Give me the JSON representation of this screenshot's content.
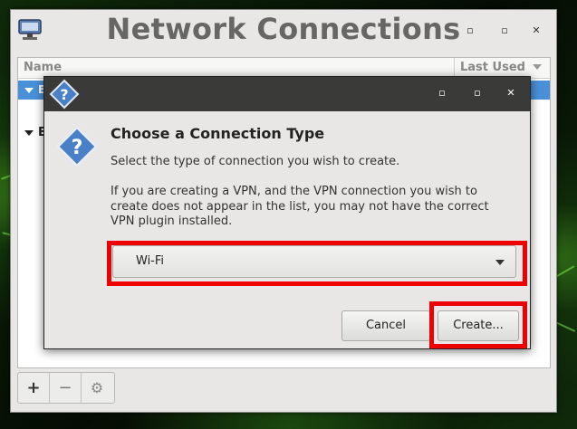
{
  "main_window": {
    "title": "Network Connections",
    "controls": {
      "minimize": "▫",
      "maximize": "▫",
      "close": "✕"
    },
    "list": {
      "col_name": "Name",
      "col_last_used": "Last Used",
      "rows": [
        "E",
        "E"
      ]
    },
    "toolbar": {
      "add": "+",
      "remove": "−",
      "settings": "⚙"
    }
  },
  "dialog": {
    "controls": {
      "minimize": "▫",
      "maximize": "▫",
      "close": "✕"
    },
    "heading": "Choose a Connection Type",
    "subtitle": "Select the type of connection you wish to create.",
    "note": "If you are creating a VPN, and the VPN connection you wish to create does not appear in the list, you may not have the correct VPN plugin installed.",
    "connection_type": {
      "selected": "Wi-Fi"
    },
    "cancel_label": "Cancel",
    "create_label": "Create..."
  },
  "colors": {
    "selection": "#4a90d9",
    "highlight": "#ee0000",
    "dialog_titlebar": "#3a3a38",
    "window_bg": "#e8e7e5"
  },
  "icons": {
    "app_icon": "network-icon",
    "dialog_icon": "question-diamond-icon"
  }
}
